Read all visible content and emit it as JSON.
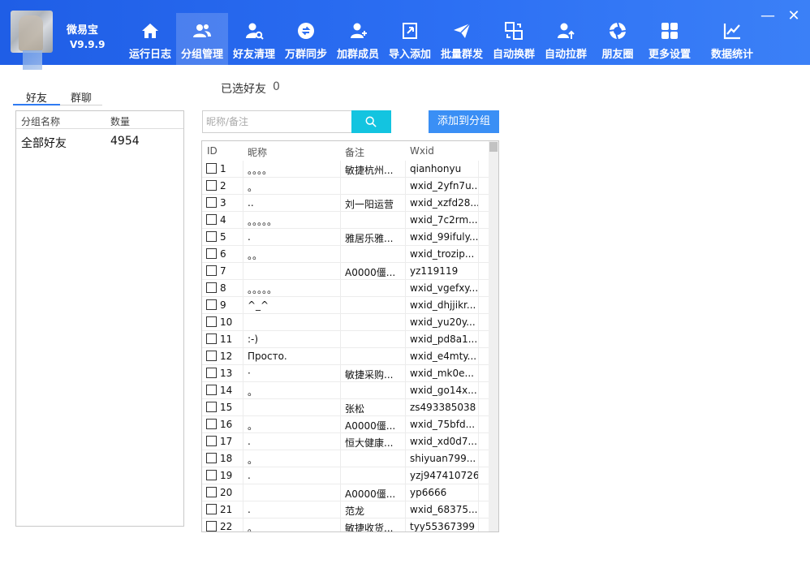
{
  "app": {
    "name": "微易宝",
    "version": "V9.9.9"
  },
  "nav": [
    {
      "label": "运行日志",
      "icon": "home-icon"
    },
    {
      "label": "分组管理",
      "icon": "group-users-icon",
      "active": true
    },
    {
      "label": "好友清理",
      "icon": "user-search-icon"
    },
    {
      "label": "万群同步",
      "icon": "sync-circle-icon"
    },
    {
      "label": "加群成员",
      "icon": "add-user-icon"
    },
    {
      "label": "导入添加",
      "icon": "import-icon"
    },
    {
      "label": "批量群发",
      "icon": "send-plane-icon"
    },
    {
      "label": "自动换群",
      "icon": "swap-windows-icon"
    },
    {
      "label": "自动拉群",
      "icon": "user-up-icon"
    },
    {
      "label": "朋友圈",
      "icon": "aperture-icon"
    },
    {
      "label": "更多设置",
      "icon": "grid-icon"
    },
    {
      "label": "数据统计",
      "icon": "line-chart-icon"
    }
  ],
  "window": {
    "minimize": "—",
    "close": "✕"
  },
  "left": {
    "tabs": [
      "好友",
      "群聊"
    ],
    "headers": {
      "name": "分组名称",
      "count": "数量"
    },
    "rows": [
      {
        "name": "全部好友",
        "count": "4954"
      }
    ]
  },
  "selected": {
    "label": "已选好友",
    "count": "0"
  },
  "search": {
    "placeholder": "昵称/备注"
  },
  "add_button": "添加到分组",
  "table": {
    "headers": {
      "id": "ID",
      "nick": "昵称",
      "remark": "备注",
      "wxid": "Wxid"
    },
    "rows": [
      {
        "id": "1",
        "nick": "。。。。",
        "remark": "敏捷杭州...",
        "wxid": "qianhonyu"
      },
      {
        "id": "2",
        "nick": "。",
        "remark": "",
        "wxid": "wxid_2yfn7u..."
      },
      {
        "id": "3",
        "nick": "..",
        "remark": "刘一阳运营",
        "wxid": "wxid_xzfd28..."
      },
      {
        "id": "4",
        "nick": "。。。。。",
        "remark": "",
        "wxid": "wxid_7c2rm..."
      },
      {
        "id": "5",
        "nick": ".",
        "remark": "雅居乐雅...",
        "wxid": "wxid_99ifuly..."
      },
      {
        "id": "6",
        "nick": "。。",
        "remark": "",
        "wxid": "wxid_trozip..."
      },
      {
        "id": "7",
        "nick": "",
        "remark": "A0000僵...",
        "wxid": "yz119119"
      },
      {
        "id": "8",
        "nick": "。。。。。",
        "remark": "",
        "wxid": "wxid_vgefxy..."
      },
      {
        "id": "9",
        "nick": "^_^",
        "remark": "",
        "wxid": "wxid_dhjjikr..."
      },
      {
        "id": "10",
        "nick": "",
        "remark": "",
        "wxid": "wxid_yu20y..."
      },
      {
        "id": "11",
        "nick": ":-)",
        "remark": "",
        "wxid": "wxid_pd8a1..."
      },
      {
        "id": "12",
        "nick": "Просто.",
        "remark": "",
        "wxid": "wxid_e4mty..."
      },
      {
        "id": "13",
        "nick": "·",
        "remark": "敏捷采购...",
        "wxid": "wxid_mk0e..."
      },
      {
        "id": "14",
        "nick": "。",
        "remark": "",
        "wxid": "wxid_go14x..."
      },
      {
        "id": "15",
        "nick": "",
        "remark": "张松",
        "wxid": "zs493385038"
      },
      {
        "id": "16",
        "nick": "。",
        "remark": "A0000僵...",
        "wxid": "wxid_75bfd..."
      },
      {
        "id": "17",
        "nick": ".",
        "remark": "恒大健康...",
        "wxid": "wxid_xd0d7..."
      },
      {
        "id": "18",
        "nick": "。",
        "remark": "",
        "wxid": "shiyuan799..."
      },
      {
        "id": "19",
        "nick": ".",
        "remark": "",
        "wxid": "yzj947410726"
      },
      {
        "id": "20",
        "nick": "",
        "remark": "A0000僵...",
        "wxid": "yp6666"
      },
      {
        "id": "21",
        "nick": ".",
        "remark": "范龙",
        "wxid": "wxid_68375..."
      },
      {
        "id": "22",
        "nick": "。",
        "remark": "敏捷收货...",
        "wxid": "tyy55367399"
      }
    ]
  }
}
